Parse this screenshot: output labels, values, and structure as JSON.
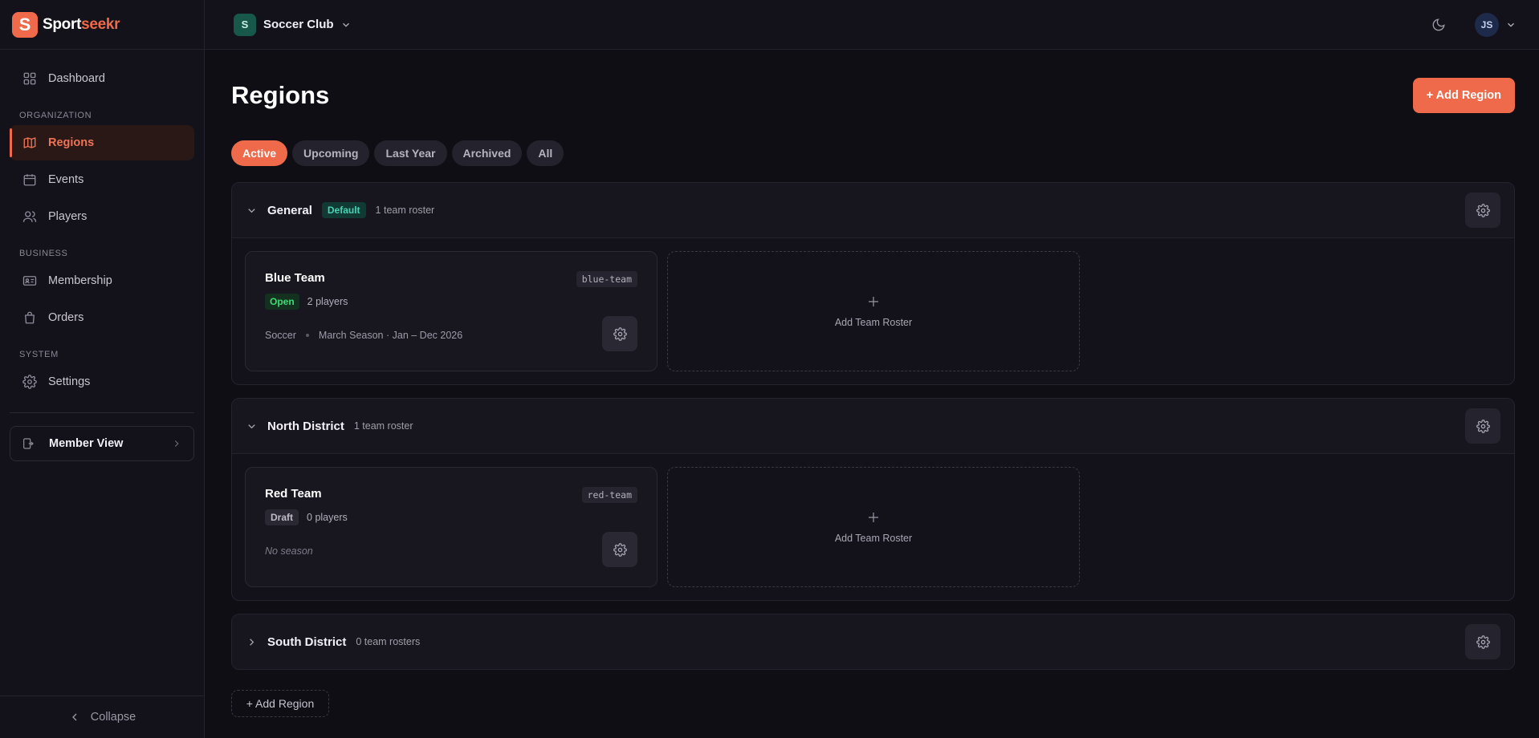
{
  "brand": {
    "name_part1": "Sport",
    "name_part2": "seekr",
    "logo_letter": "S",
    "accent": "#ee6a4a"
  },
  "sidebar": {
    "top_item": {
      "label": "Dashboard",
      "icon": "grid-icon"
    },
    "sections": [
      {
        "title": "ORGANIZATION",
        "items": [
          {
            "label": "Regions",
            "icon": "map-icon",
            "active": true
          },
          {
            "label": "Events",
            "icon": "calendar-icon"
          },
          {
            "label": "Players",
            "icon": "users-icon"
          }
        ]
      },
      {
        "title": "BUSINESS",
        "items": [
          {
            "label": "Membership",
            "icon": "id-card-icon"
          },
          {
            "label": "Orders",
            "icon": "shopping-bag-icon"
          }
        ]
      },
      {
        "title": "SYSTEM",
        "items": [
          {
            "label": "Settings",
            "icon": "gear-icon"
          }
        ]
      }
    ],
    "member_view": "Member View",
    "collapse": "Collapse"
  },
  "topbar": {
    "org_badge": "S",
    "org_name": "Soccer Club",
    "avatar_initials": "JS"
  },
  "page": {
    "title": "Regions",
    "add_button": "+ Add Region",
    "tabs": [
      {
        "label": "Active",
        "active": true
      },
      {
        "label": "Upcoming"
      },
      {
        "label": "Last Year"
      },
      {
        "label": "Archived"
      },
      {
        "label": "All"
      }
    ],
    "regions": [
      {
        "name": "General",
        "badge": "Default",
        "count": "1 team roster",
        "expanded": true,
        "teams": [
          {
            "name": "Blue Team",
            "slug": "blue-team",
            "status": "Open",
            "players": "2 players",
            "sport": "Soccer",
            "season": "March Season · Jan – Dec 2026"
          }
        ],
        "add_roster": "Add Team Roster"
      },
      {
        "name": "North District",
        "count": "1 team roster",
        "expanded": true,
        "teams": [
          {
            "name": "Red Team",
            "slug": "red-team",
            "status": "Draft",
            "players": "0 players",
            "season": "No season"
          }
        ],
        "add_roster": "Add Team Roster"
      },
      {
        "name": "South District",
        "count": "0 team rosters",
        "expanded": false
      }
    ],
    "bottom_add": "+ Add Region"
  }
}
